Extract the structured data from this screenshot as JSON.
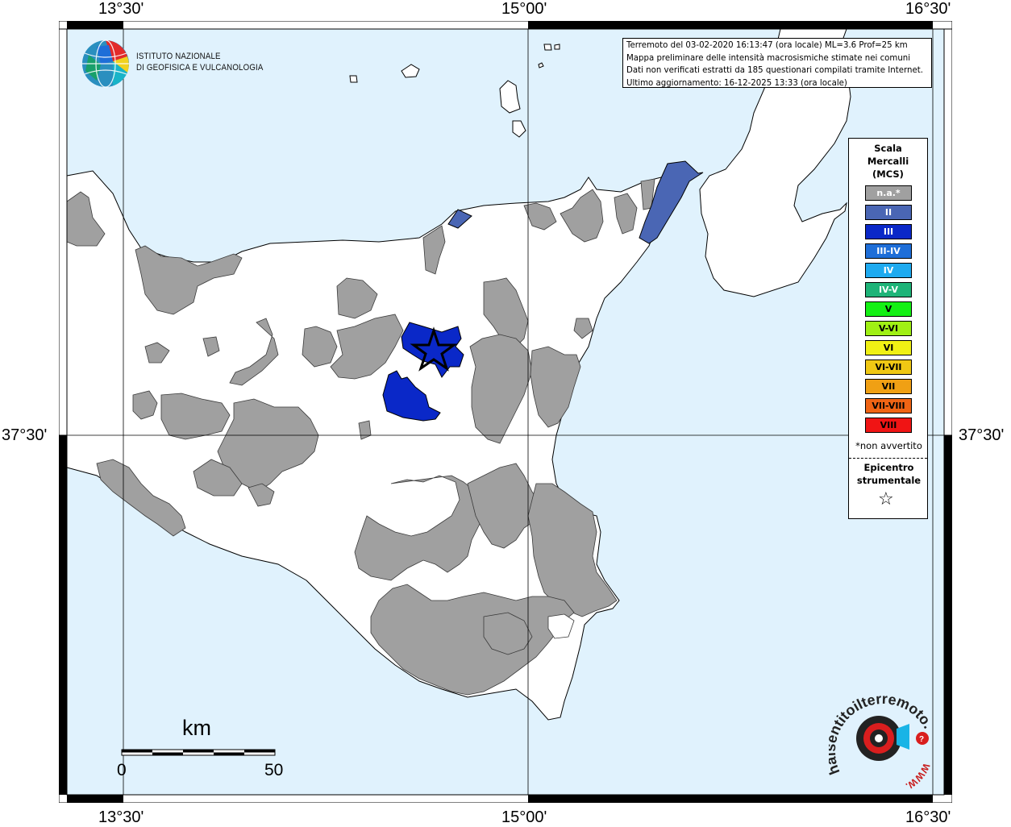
{
  "map": {
    "lon_ticks_top": [
      "13°30'",
      "15°00'",
      "16°30'"
    ],
    "lon_ticks_bottom": [
      "13°30'",
      "15°00'",
      "16°30'"
    ],
    "lat_ticks": [
      "37°30'",
      "37°30'"
    ],
    "colors": {
      "sea": "#e0f2fd",
      "land": "#ffffff",
      "not_felt": "#a0a0a0",
      "intensity_II": "#4a66b4",
      "intensity_III": "#0a28c8"
    }
  },
  "info": {
    "line1": "Terremoto del 03-02-2020 16:13:47 (ora locale) ML=3.6 Prof=25 km",
    "line2": "Mappa preliminare delle intensità macrosismiche stimate nei comuni",
    "line3": "Dati non verificati estratti da 185 questionari compilati tramite Internet.",
    "line4": "Ultimo aggiornamento: 16-12-2025 13:33 (ora locale)"
  },
  "legend": {
    "title_line1": "Scala",
    "title_line2": "Mercalli",
    "title_line3": "(MCS)",
    "items": [
      {
        "label": "n.a.*",
        "color": "#a0a0a0",
        "text_color": "#ffffff"
      },
      {
        "label": "II",
        "color": "#4a66b4",
        "text_color": "#ffffff"
      },
      {
        "label": "III",
        "color": "#0a28c8",
        "text_color": "#ffffff"
      },
      {
        "label": "III-IV",
        "color": "#1e6ed8",
        "text_color": "#ffffff"
      },
      {
        "label": "IV",
        "color": "#1eaaf0",
        "text_color": "#ffffff"
      },
      {
        "label": "IV-V",
        "color": "#1eb478",
        "text_color": "#ffffff"
      },
      {
        "label": "V",
        "color": "#14f014",
        "text_color": "#000000"
      },
      {
        "label": "V-VI",
        "color": "#a0f014",
        "text_color": "#000000"
      },
      {
        "label": "VI",
        "color": "#f0f014",
        "text_color": "#000000"
      },
      {
        "label": "VI-VII",
        "color": "#f0c814",
        "text_color": "#000000"
      },
      {
        "label": "VII",
        "color": "#f0a014",
        "text_color": "#000000"
      },
      {
        "label": "VII-VIII",
        "color": "#f06414",
        "text_color": "#000000"
      },
      {
        "label": "VIII",
        "color": "#f01414",
        "text_color": "#000000"
      }
    ],
    "note": "*non avvertito",
    "epicenter_line1": "Epicentro",
    "epicenter_line2": "strumentale",
    "epicenter_symbol": "☆"
  },
  "ingv": {
    "line1": "ISTITUTO NAZIONALE",
    "line2": "DI GEOFISICA E VULCANOLOGIA"
  },
  "scalebar": {
    "unit": "km",
    "min_label": "0",
    "max_label": "50"
  },
  "hsit": {
    "text": "haisentitoilterremoto.it",
    "www": "WWW."
  }
}
